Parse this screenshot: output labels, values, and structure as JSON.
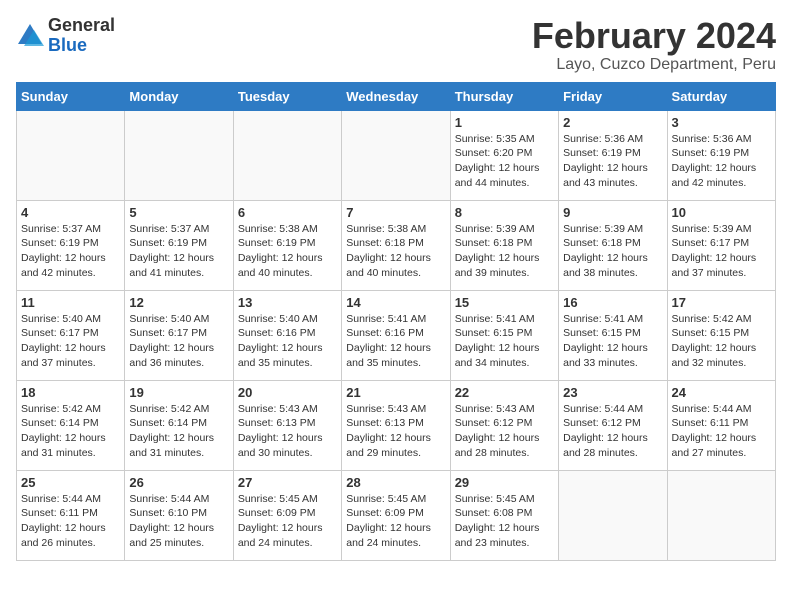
{
  "header": {
    "logo_general": "General",
    "logo_blue": "Blue",
    "main_title": "February 2024",
    "subtitle": "Layo, Cuzco Department, Peru"
  },
  "calendar": {
    "weekdays": [
      "Sunday",
      "Monday",
      "Tuesday",
      "Wednesday",
      "Thursday",
      "Friday",
      "Saturday"
    ],
    "weeks": [
      [
        {
          "day": "",
          "info": ""
        },
        {
          "day": "",
          "info": ""
        },
        {
          "day": "",
          "info": ""
        },
        {
          "day": "",
          "info": ""
        },
        {
          "day": "1",
          "info": "Sunrise: 5:35 AM\nSunset: 6:20 PM\nDaylight: 12 hours and 44 minutes."
        },
        {
          "day": "2",
          "info": "Sunrise: 5:36 AM\nSunset: 6:19 PM\nDaylight: 12 hours and 43 minutes."
        },
        {
          "day": "3",
          "info": "Sunrise: 5:36 AM\nSunset: 6:19 PM\nDaylight: 12 hours and 42 minutes."
        }
      ],
      [
        {
          "day": "4",
          "info": "Sunrise: 5:37 AM\nSunset: 6:19 PM\nDaylight: 12 hours and 42 minutes."
        },
        {
          "day": "5",
          "info": "Sunrise: 5:37 AM\nSunset: 6:19 PM\nDaylight: 12 hours and 41 minutes."
        },
        {
          "day": "6",
          "info": "Sunrise: 5:38 AM\nSunset: 6:19 PM\nDaylight: 12 hours and 40 minutes."
        },
        {
          "day": "7",
          "info": "Sunrise: 5:38 AM\nSunset: 6:18 PM\nDaylight: 12 hours and 40 minutes."
        },
        {
          "day": "8",
          "info": "Sunrise: 5:39 AM\nSunset: 6:18 PM\nDaylight: 12 hours and 39 minutes."
        },
        {
          "day": "9",
          "info": "Sunrise: 5:39 AM\nSunset: 6:18 PM\nDaylight: 12 hours and 38 minutes."
        },
        {
          "day": "10",
          "info": "Sunrise: 5:39 AM\nSunset: 6:17 PM\nDaylight: 12 hours and 37 minutes."
        }
      ],
      [
        {
          "day": "11",
          "info": "Sunrise: 5:40 AM\nSunset: 6:17 PM\nDaylight: 12 hours and 37 minutes."
        },
        {
          "day": "12",
          "info": "Sunrise: 5:40 AM\nSunset: 6:17 PM\nDaylight: 12 hours and 36 minutes."
        },
        {
          "day": "13",
          "info": "Sunrise: 5:40 AM\nSunset: 6:16 PM\nDaylight: 12 hours and 35 minutes."
        },
        {
          "day": "14",
          "info": "Sunrise: 5:41 AM\nSunset: 6:16 PM\nDaylight: 12 hours and 35 minutes."
        },
        {
          "day": "15",
          "info": "Sunrise: 5:41 AM\nSunset: 6:15 PM\nDaylight: 12 hours and 34 minutes."
        },
        {
          "day": "16",
          "info": "Sunrise: 5:41 AM\nSunset: 6:15 PM\nDaylight: 12 hours and 33 minutes."
        },
        {
          "day": "17",
          "info": "Sunrise: 5:42 AM\nSunset: 6:15 PM\nDaylight: 12 hours and 32 minutes."
        }
      ],
      [
        {
          "day": "18",
          "info": "Sunrise: 5:42 AM\nSunset: 6:14 PM\nDaylight: 12 hours and 31 minutes."
        },
        {
          "day": "19",
          "info": "Sunrise: 5:42 AM\nSunset: 6:14 PM\nDaylight: 12 hours and 31 minutes."
        },
        {
          "day": "20",
          "info": "Sunrise: 5:43 AM\nSunset: 6:13 PM\nDaylight: 12 hours and 30 minutes."
        },
        {
          "day": "21",
          "info": "Sunrise: 5:43 AM\nSunset: 6:13 PM\nDaylight: 12 hours and 29 minutes."
        },
        {
          "day": "22",
          "info": "Sunrise: 5:43 AM\nSunset: 6:12 PM\nDaylight: 12 hours and 28 minutes."
        },
        {
          "day": "23",
          "info": "Sunrise: 5:44 AM\nSunset: 6:12 PM\nDaylight: 12 hours and 28 minutes."
        },
        {
          "day": "24",
          "info": "Sunrise: 5:44 AM\nSunset: 6:11 PM\nDaylight: 12 hours and 27 minutes."
        }
      ],
      [
        {
          "day": "25",
          "info": "Sunrise: 5:44 AM\nSunset: 6:11 PM\nDaylight: 12 hours and 26 minutes."
        },
        {
          "day": "26",
          "info": "Sunrise: 5:44 AM\nSunset: 6:10 PM\nDaylight: 12 hours and 25 minutes."
        },
        {
          "day": "27",
          "info": "Sunrise: 5:45 AM\nSunset: 6:09 PM\nDaylight: 12 hours and 24 minutes."
        },
        {
          "day": "28",
          "info": "Sunrise: 5:45 AM\nSunset: 6:09 PM\nDaylight: 12 hours and 24 minutes."
        },
        {
          "day": "29",
          "info": "Sunrise: 5:45 AM\nSunset: 6:08 PM\nDaylight: 12 hours and 23 minutes."
        },
        {
          "day": "",
          "info": ""
        },
        {
          "day": "",
          "info": ""
        }
      ]
    ]
  }
}
